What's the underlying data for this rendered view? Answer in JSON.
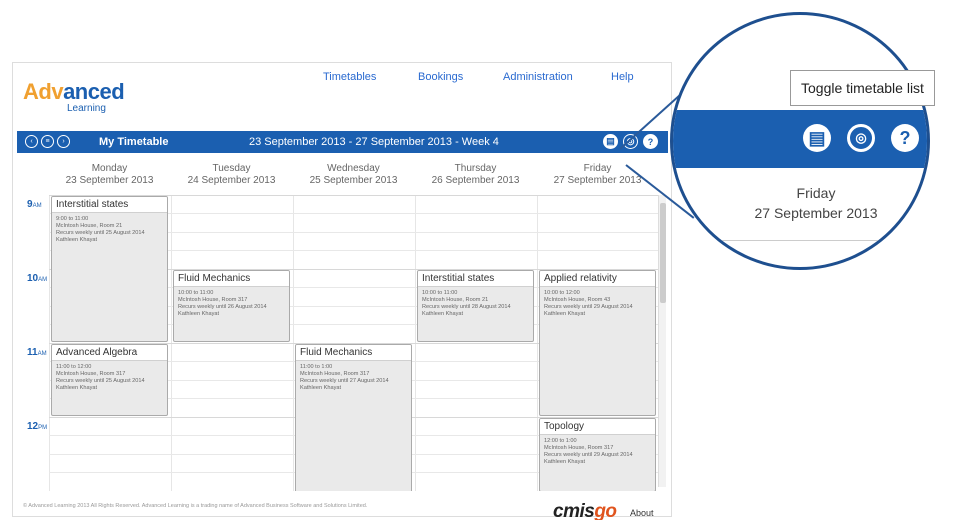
{
  "logo": {
    "brand_part1": "Adv",
    "brand_part2": "anced",
    "subtitle": "Learning"
  },
  "topnav": {
    "timetables": "Timetables",
    "bookings": "Bookings",
    "administration": "Administration",
    "help": "Help"
  },
  "toolbar": {
    "title": "My Timetable",
    "date_range": "23 September 2013 - 27 September 2013 - Week 4",
    "nav_buttons": [
      "‹",
      "≡",
      "›"
    ],
    "tools": [
      "▤",
      "◎",
      "?"
    ]
  },
  "days": [
    {
      "name": "Monday",
      "date": "23 September 2013"
    },
    {
      "name": "Tuesday",
      "date": "24 September 2013"
    },
    {
      "name": "Wednesday",
      "date": "25 September 2013"
    },
    {
      "name": "Thursday",
      "date": "26 September 2013"
    },
    {
      "name": "Friday",
      "date": "27 September 2013"
    }
  ],
  "hours": [
    {
      "label": "9",
      "suffix": "AM"
    },
    {
      "label": "10",
      "suffix": "AM"
    },
    {
      "label": "11",
      "suffix": "AM"
    },
    {
      "label": "12",
      "suffix": "PM"
    }
  ],
  "events": [
    {
      "title": "Interstitial states",
      "time": "9:00 to 11:00",
      "place": "McIntosh House, Room 21",
      "recur": "Recurs weekly until 25 August 2014",
      "person": "Kathleen Khayat"
    },
    {
      "title": "Fluid Mechanics",
      "time": "10:00 to 11:00",
      "place": "McIntosh House, Room 317",
      "recur": "Recurs weekly until 26 August 2014",
      "person": "Kathleen Khayat"
    },
    {
      "title": "Interstitial states",
      "time": "10:00 to 11:00",
      "place": "McIntosh House, Room 21",
      "recur": "Recurs weekly until 28 August 2014",
      "person": "Kathleen Khayat"
    },
    {
      "title": "Applied relativity",
      "time": "10:00 to 12:00",
      "place": "McIntosh House, Room 43",
      "recur": "Recurs weekly until 29 August 2014",
      "person": "Kathleen Khayat"
    },
    {
      "title": "Advanced Algebra",
      "time": "11:00 to 12:00",
      "place": "McIntosh House, Room 317",
      "recur": "Recurs weekly until 25 August 2014",
      "person": "Kathleen Khayat"
    },
    {
      "title": "Fluid Mechanics",
      "time": "11:00 to 1:00",
      "place": "McIntosh House, Room 317",
      "recur": "Recurs weekly until 27 August 2014",
      "person": "Kathleen Khayat"
    },
    {
      "title": "Topology",
      "time": "12:00 to 1:00",
      "place": "McIntosh House, Room 317",
      "recur": "Recurs weekly until 29 August 2014",
      "person": "Kathleen Khayat"
    }
  ],
  "footer": {
    "copyright": "© Advanced Learning 2013 All Rights Reserved. Advanced Learning is a trading name of Advanced Business Software and Solutions Limited.",
    "brand_part1": "cmis",
    "brand_part2": "go",
    "about": "About"
  },
  "zoom": {
    "tooltip": "Toggle timetable list",
    "day_name": "Friday",
    "day_date": "27 September 2013"
  },
  "colors": {
    "brand_blue": "#1b5fb0",
    "logo_orange": "#f0a030",
    "cmisgo_orange": "#e0541e"
  }
}
